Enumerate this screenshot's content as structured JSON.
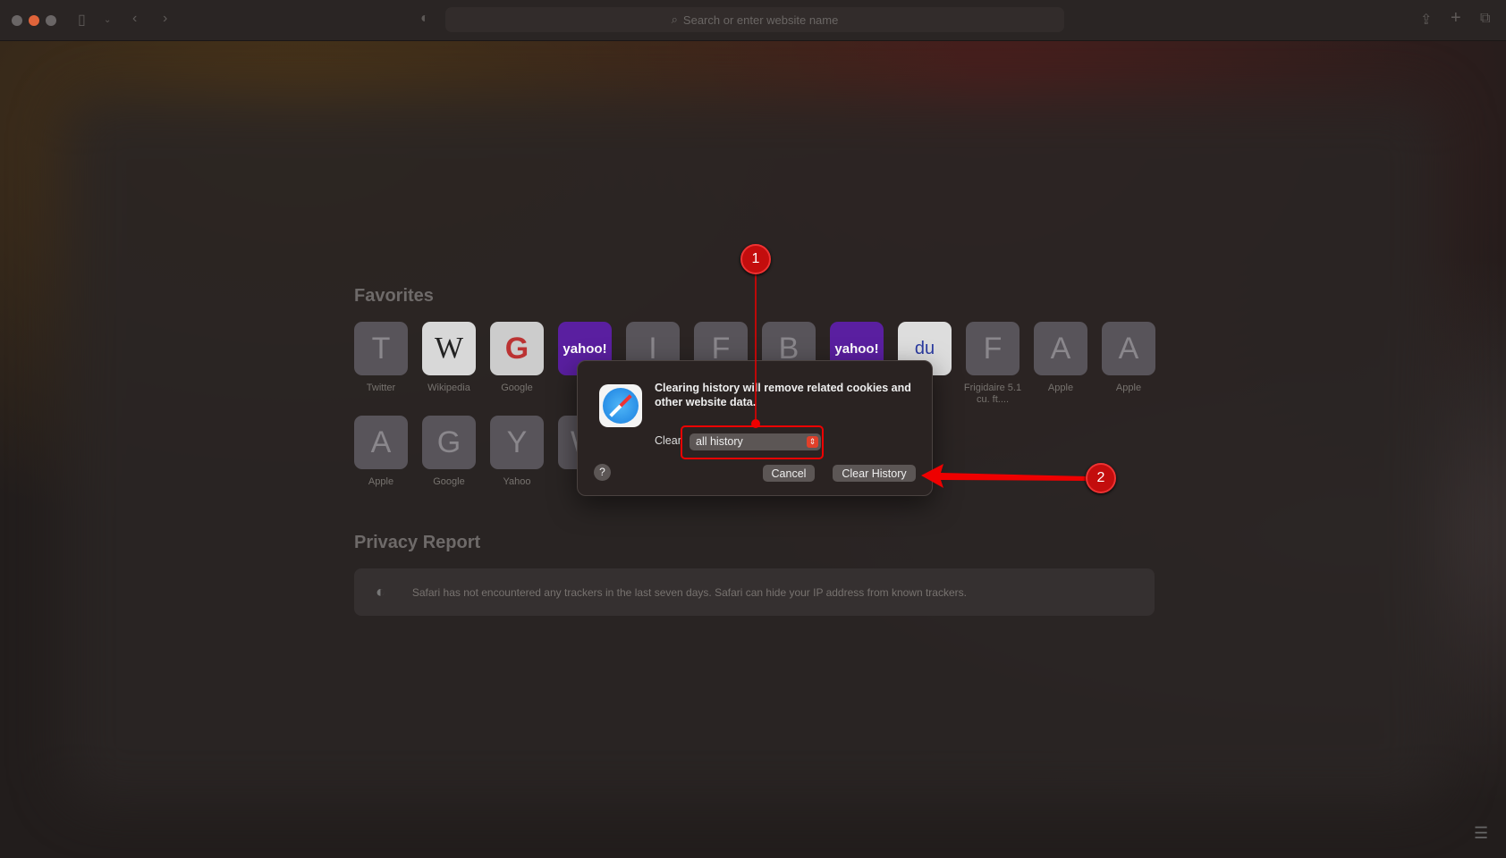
{
  "toolbar": {
    "search_placeholder": "Search or enter website name",
    "icons": [
      "sidebar-icon",
      "chevron-down-icon",
      "back-icon",
      "forward-icon",
      "shield-icon",
      "search-icon",
      "share-icon",
      "new-tab-icon",
      "tabs-overview-icon"
    ]
  },
  "favorites": {
    "title": "Favorites",
    "row1": [
      {
        "letter": "T",
        "label": "Twitter"
      },
      {
        "letter": "W",
        "label": "Wikipedia",
        "style": "wiki"
      },
      {
        "letter": "G",
        "label": "Google",
        "style": "google"
      },
      {
        "letter": "yahoo!",
        "label": "",
        "style": "yahoo"
      },
      {
        "letter": "I",
        "label": ""
      },
      {
        "letter": "F",
        "label": ""
      },
      {
        "letter": "B",
        "label": ""
      },
      {
        "letter": "yahoo!",
        "label": "",
        "style": "yahoo"
      },
      {
        "letter": "du",
        "label": "",
        "style": "baidu"
      },
      {
        "letter": "F",
        "label": "Frigidaire 5.1 cu. ft...."
      },
      {
        "letter": "A",
        "label": "Apple"
      },
      {
        "letter": "A",
        "label": "Apple"
      }
    ],
    "row2": [
      {
        "letter": "A",
        "label": "Apple"
      },
      {
        "letter": "G",
        "label": "Google"
      },
      {
        "letter": "Y",
        "label": "Yahoo"
      },
      {
        "letter": "W",
        "label": ""
      }
    ]
  },
  "privacy": {
    "title": "Privacy Report",
    "message": "Safari has not encountered any trackers in the last seven days. Safari can hide your IP address from known trackers."
  },
  "dialog": {
    "message": "Clearing history will remove related cookies and other website data.",
    "clear_label": "Clear",
    "clear_value": "all history",
    "cancel": "Cancel",
    "confirm": "Clear History",
    "help": "?"
  },
  "annotations": {
    "step1": "1",
    "step2": "2",
    "color": "#e00000"
  }
}
